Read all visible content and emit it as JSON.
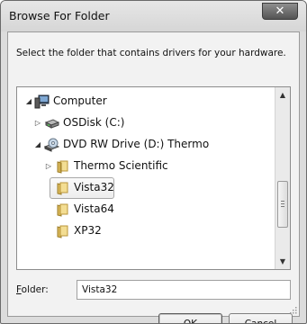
{
  "window": {
    "title": "Browse For Folder",
    "close_symbol": "✕"
  },
  "prompt": "Select the folder that contains drivers for your hardware.",
  "tree": {
    "items": [
      {
        "label": "Computer",
        "icon": "computer-icon",
        "expander": "expanded"
      },
      {
        "label": "OSDisk (C:)",
        "icon": "hard-drive-icon",
        "expander": "collapsed"
      },
      {
        "label": "DVD RW Drive (D:) Thermo",
        "icon": "dvd-drive-icon",
        "expander": "expanded"
      },
      {
        "label": "Thermo Scientific",
        "icon": "folder-icon",
        "expander": "collapsed"
      },
      {
        "label": "Vista32",
        "icon": "folder-icon",
        "expander": "none",
        "selected": true
      },
      {
        "label": "Vista64",
        "icon": "folder-icon",
        "expander": "none"
      },
      {
        "label": "XP32",
        "icon": "folder-icon",
        "expander": "none"
      }
    ]
  },
  "folder_field": {
    "label_accel": "F",
    "label_rest": "older:",
    "value": "Vista32"
  },
  "buttons": {
    "ok": "OK",
    "cancel": "Cancel"
  },
  "colors": {
    "folder": "#e8c86a",
    "selection_border": "#9c9c9c"
  }
}
